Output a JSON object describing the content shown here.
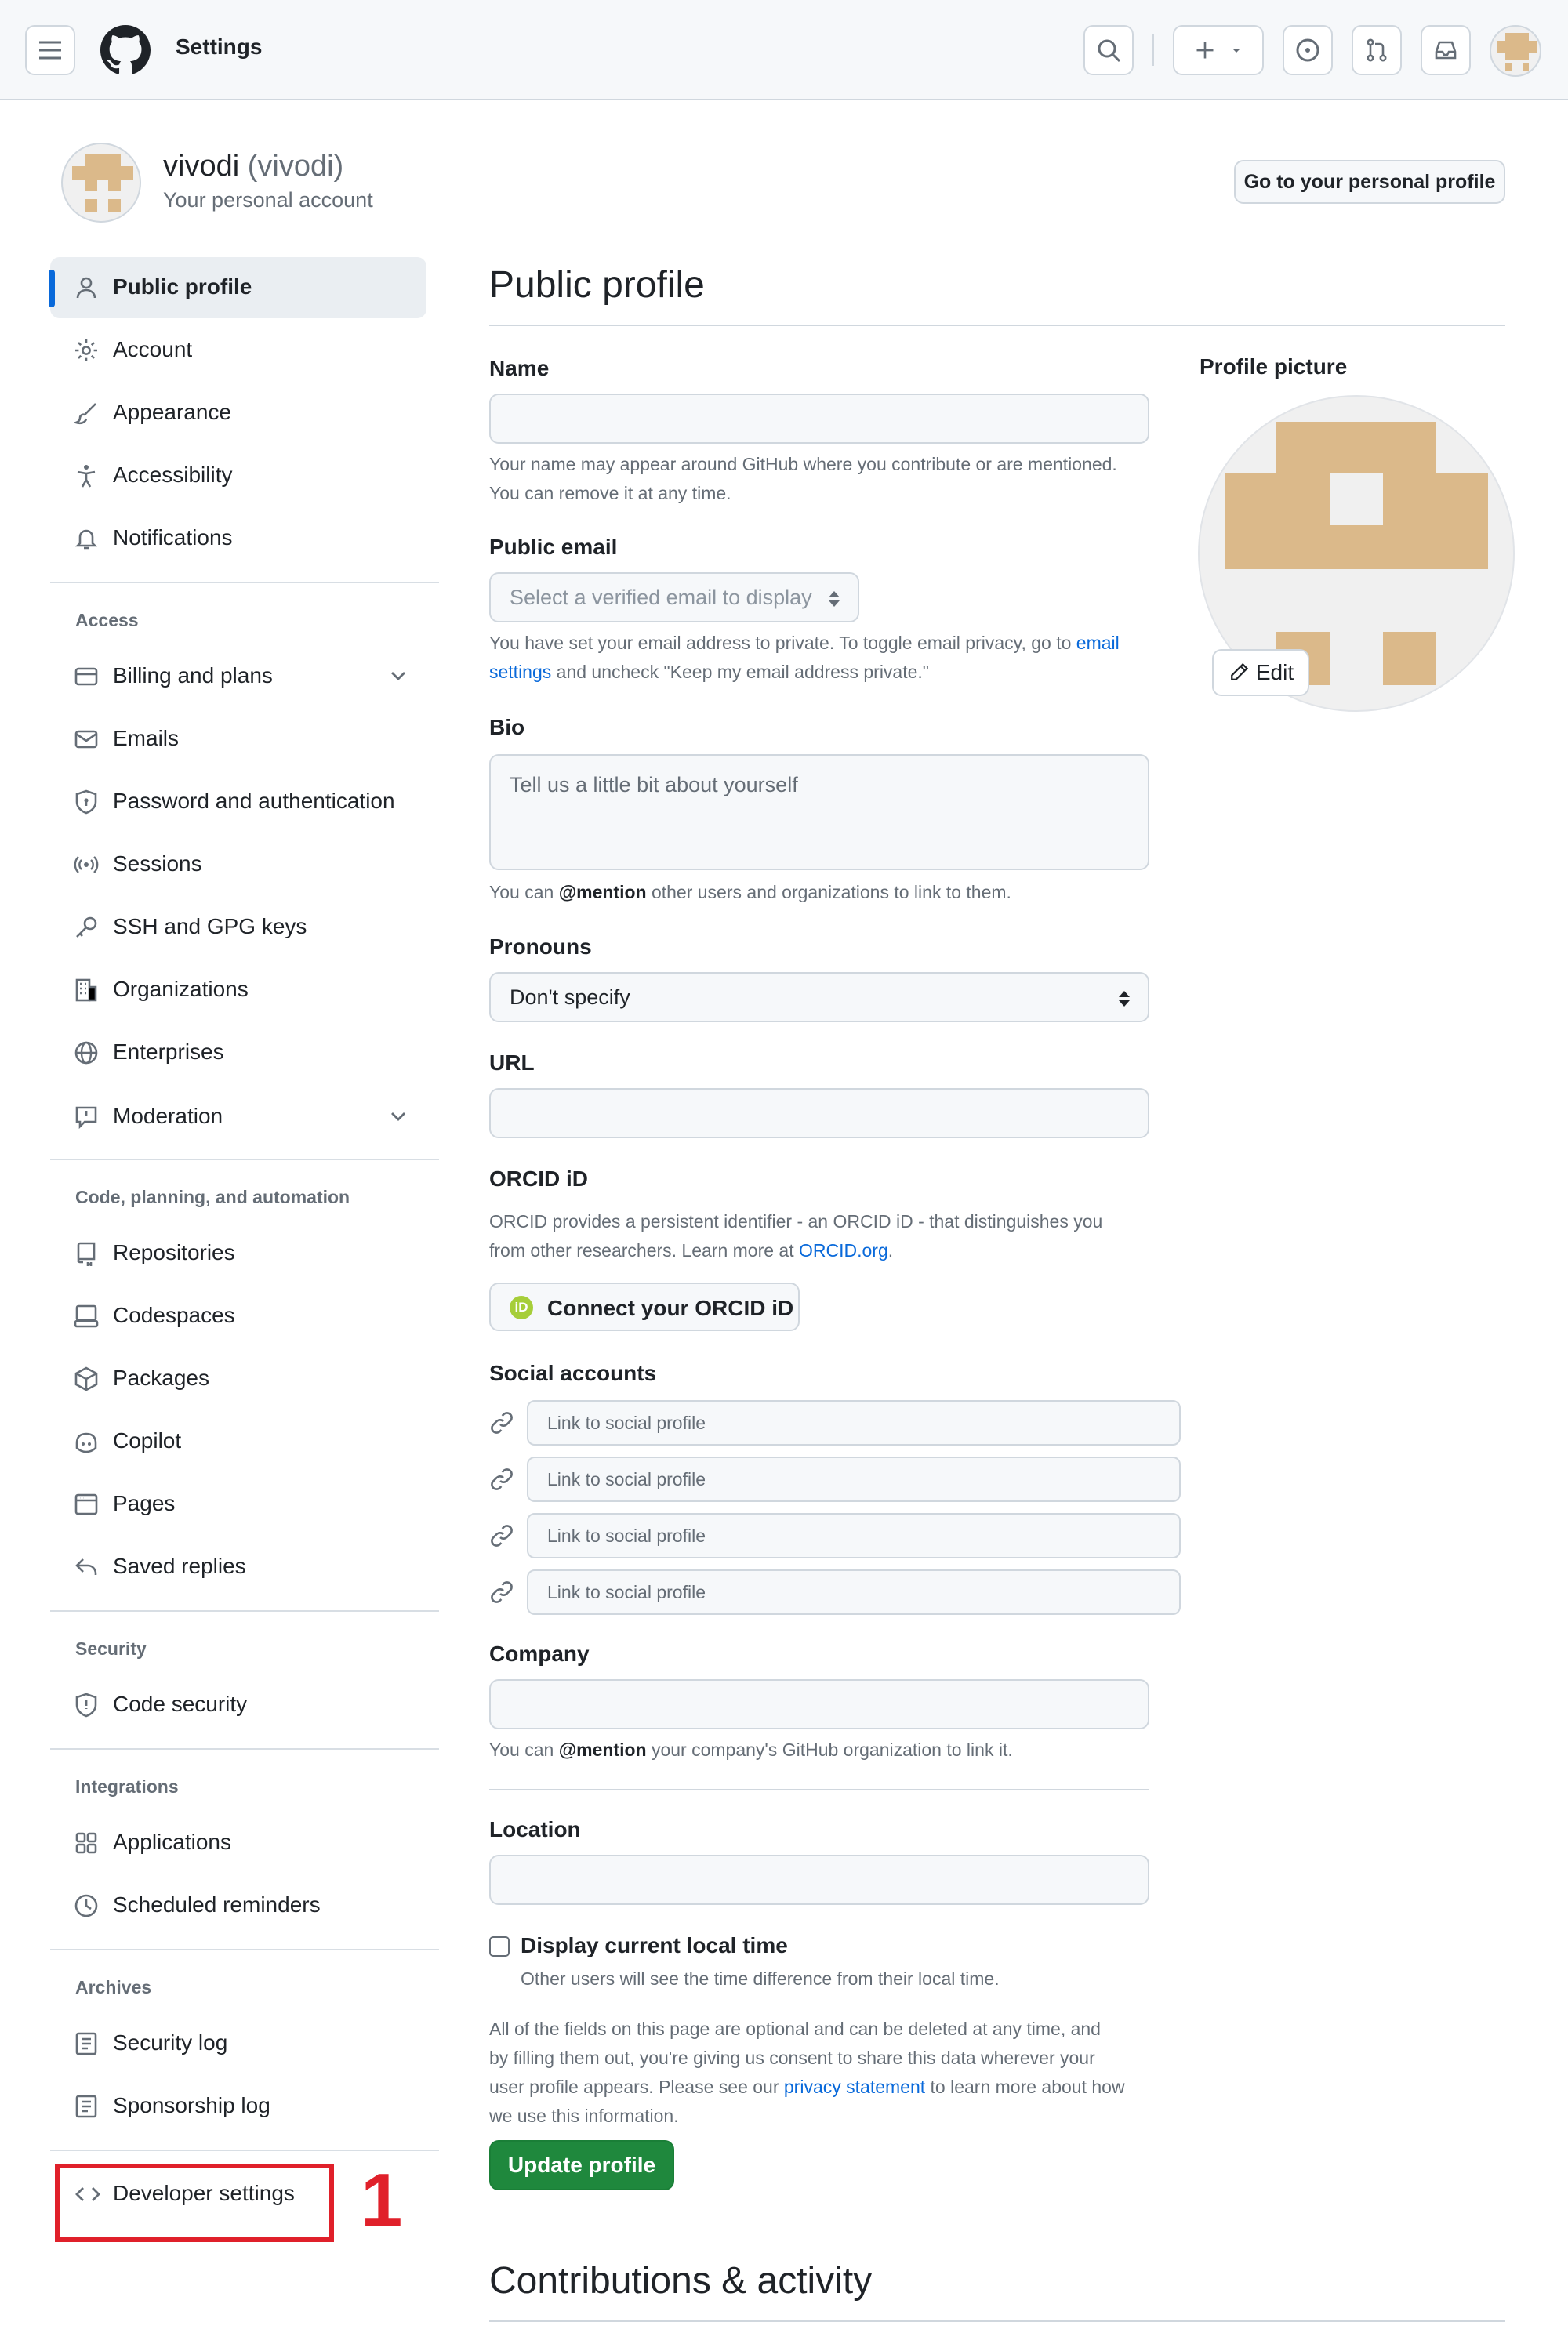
{
  "header": {
    "title": "Settings"
  },
  "context": {
    "username": "vivodi",
    "handle": "(vivodi)",
    "subtitle": "Your personal account",
    "profile_button": "Go to your personal profile"
  },
  "sidebar": {
    "top_items": [
      {
        "label": "Public profile",
        "icon": "person-icon",
        "active": true
      },
      {
        "label": "Account",
        "icon": "gear-icon"
      },
      {
        "label": "Appearance",
        "icon": "paintbrush-icon"
      },
      {
        "label": "Accessibility",
        "icon": "accessibility-icon"
      },
      {
        "label": "Notifications",
        "icon": "bell-icon"
      }
    ],
    "access_heading": "Access",
    "access_items": [
      {
        "label": "Billing and plans",
        "icon": "credit-card-icon"
      },
      {
        "label": "Emails",
        "icon": "mail-icon"
      },
      {
        "label": "Password and authentication",
        "icon": "shield-lock-icon"
      },
      {
        "label": "Sessions",
        "icon": "broadcast-icon"
      },
      {
        "label": "SSH and GPG keys",
        "icon": "key-icon"
      },
      {
        "label": "Organizations",
        "icon": "organization-icon"
      },
      {
        "label": "Enterprises",
        "icon": "globe-icon"
      },
      {
        "label": "Moderation",
        "icon": "report-icon"
      }
    ],
    "code_heading": "Code, planning, and automation",
    "code_items": [
      {
        "label": "Repositories",
        "icon": "repo-icon"
      },
      {
        "label": "Codespaces",
        "icon": "codespaces-icon"
      },
      {
        "label": "Packages",
        "icon": "package-icon"
      },
      {
        "label": "Copilot",
        "icon": "copilot-icon"
      },
      {
        "label": "Pages",
        "icon": "browser-icon"
      },
      {
        "label": "Saved replies",
        "icon": "reply-icon"
      }
    ],
    "security_heading": "Security",
    "security_items": [
      {
        "label": "Code security",
        "icon": "shield-icon"
      }
    ],
    "integrations_heading": "Integrations",
    "integrations_items": [
      {
        "label": "Applications",
        "icon": "apps-icon"
      },
      {
        "label": "Scheduled reminders",
        "icon": "clock-icon"
      }
    ],
    "archives_heading": "Archives",
    "archives_items": [
      {
        "label": "Security log",
        "icon": "log-icon"
      },
      {
        "label": "Sponsorship log",
        "icon": "log-icon"
      }
    ],
    "developer_settings": "Developer settings"
  },
  "main": {
    "title": "Public profile",
    "name_label": "Name",
    "name_value": "",
    "name_note_1": "Your name may appear around GitHub where you contribute or are mentioned.",
    "name_note_2": "You can remove it at any time.",
    "email_label": "Public email",
    "email_select": "Select a verified email to display",
    "email_note_1": "You have set your email address to private. To toggle email privacy, go to",
    "email_note_link_a": "email",
    "email_note_link_b": "settings",
    "email_note_2": "and uncheck \"Keep my email address private.\"",
    "bio_label": "Bio",
    "bio_placeholder": "Tell us a little bit about yourself",
    "bio_note_1": "You can",
    "bio_note_mention": "@mention",
    "bio_note_2": "other users and organizations to link to them.",
    "pronouns_label": "Pronouns",
    "pronouns_value": "Don't specify",
    "url_label": "URL",
    "url_value": "",
    "orcid_label": "ORCID iD",
    "orcid_note_1": "ORCID provides a persistent identifier - an ORCID iD - that distinguishes you",
    "orcid_note_2": "from other researchers. Learn more at",
    "orcid_link": "ORCID.org",
    "orcid_period": ".",
    "orcid_button": "Connect your ORCID iD",
    "orcid_badge": "iD",
    "social_label": "Social accounts",
    "social_placeholder": "Link to social profile",
    "company_label": "Company",
    "company_value": "",
    "company_note_1": "You can",
    "company_note_mention": "@mention",
    "company_note_2": "your company's GitHub organization to link it.",
    "location_label": "Location",
    "location_value": "",
    "localtime_label": "Display current local time",
    "localtime_note": "Other users will see the time difference from their local time.",
    "footer_note_1": "All of the fields on this page are optional and can be deleted at any time, and",
    "footer_note_2": "by filling them out, you're giving us consent to share this data wherever your",
    "footer_note_3a": "user profile appears. Please see our",
    "footer_note_link": "privacy statement",
    "footer_note_3b": "to learn more about how",
    "footer_note_4": "we use this information.",
    "update_button": "Update profile",
    "contributions_title": "Contributions & activity"
  },
  "profile_picture": {
    "label": "Profile picture",
    "edit_button": "Edit"
  },
  "annotation": {
    "number": "1"
  },
  "colors": {
    "accent": "#0969da",
    "primary_button": "#1f883d",
    "avatar": "#dbb98a",
    "annotation": "#e0202a"
  }
}
